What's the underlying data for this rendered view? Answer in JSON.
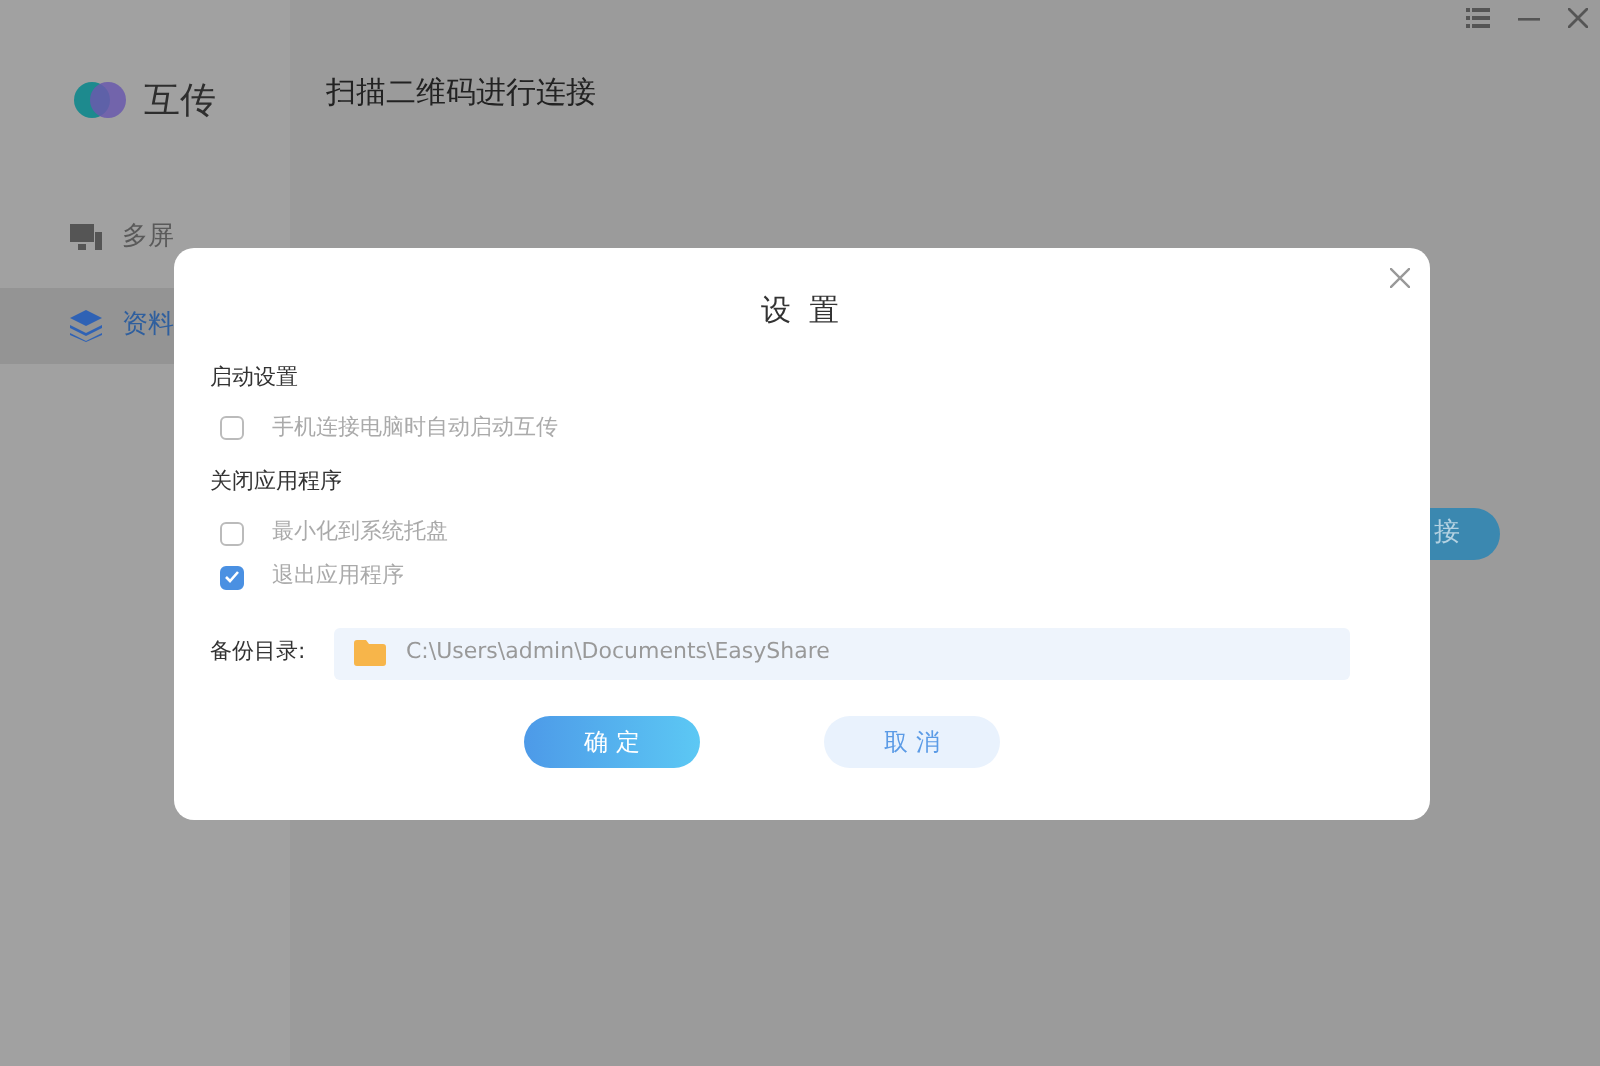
{
  "app": {
    "name": "互传"
  },
  "sidebar": {
    "items": [
      {
        "label": "多屏",
        "selected": false
      },
      {
        "label": "资料",
        "selected": true
      }
    ]
  },
  "main": {
    "heading": "扫描二维码进行连接",
    "button": "接"
  },
  "dialog": {
    "title": "设 置",
    "sections": [
      {
        "title": "启动设置",
        "options": [
          {
            "label": "手机连接电脑时自动启动互传",
            "checked": false
          }
        ]
      },
      {
        "title": "关闭应用程序",
        "options": [
          {
            "label": "最小化到系统托盘",
            "checked": false
          },
          {
            "label": "退出应用程序",
            "checked": true
          }
        ]
      }
    ],
    "backup": {
      "label": "备份目录:",
      "path": "C:\\Users\\admin\\Documents\\EasyShare"
    },
    "buttons": [
      {
        "label": "确 定",
        "kind": "primary"
      },
      {
        "label": "取 消",
        "kind": "secondary"
      }
    ]
  }
}
